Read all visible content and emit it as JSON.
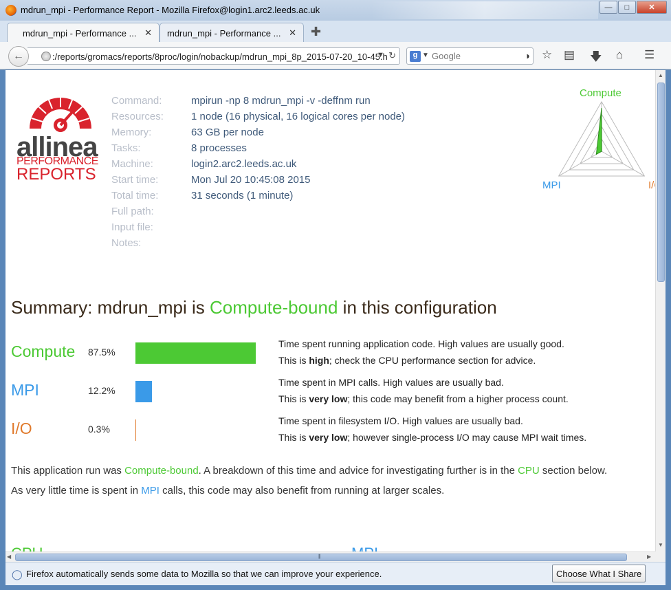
{
  "window": {
    "title": "mdrun_mpi - Performance Report - Mozilla Firefox@login1.arc2.leeds.ac.uk"
  },
  "tabs": [
    {
      "label": "mdrun_mpi - Performance ...",
      "active": true
    },
    {
      "label": "mdrun_mpi - Performance ...",
      "active": false
    }
  ],
  "nav": {
    "url": ":/reports/gromacs/reports/8proc/login/nobackup/mdrun_mpi_8p_2015-07-20_10-45.h",
    "search_placeholder": "Google",
    "search_engine_icon": "g"
  },
  "logo": {
    "word": "allinea",
    "sub1": "PERFORMANCE",
    "sub2": "REPORTS"
  },
  "meta": [
    {
      "label": "Command:",
      "value": "mpirun -np 8 mdrun_mpi -v -deffnm run"
    },
    {
      "label": "Resources:",
      "value": "1 node (16 physical, 16 logical cores per node)"
    },
    {
      "label": "Memory:",
      "value": "63 GB per node"
    },
    {
      "label": "Tasks:",
      "value": "8 processes"
    },
    {
      "label": "Machine:",
      "value": "login2.arc2.leeds.ac.uk"
    },
    {
      "label": "Start time:",
      "value": "Mon Jul 20 10:45:08 2015"
    },
    {
      "label": "Total time:",
      "value": "31 seconds (1 minute)"
    },
    {
      "label": "Full path:",
      "value": ""
    },
    {
      "label": "Input file:",
      "value": ""
    },
    {
      "label": "Notes:",
      "value": ""
    }
  ],
  "radar": {
    "labels": {
      "top": "Compute",
      "left": "MPI",
      "right": "I/O"
    },
    "values": {
      "compute": 87.5,
      "mpi": 12.2,
      "io": 0.3
    }
  },
  "summary": {
    "prefix": "Summary: mdrun_mpi is ",
    "highlight": "Compute-bound",
    "suffix": " in this configuration"
  },
  "metrics": [
    {
      "name": "Compute",
      "pct": "87.5%",
      "value": 87.5,
      "color": "#4cc934",
      "desc1": "Time spent running application code. High values are usually good.",
      "desc2_pre": "This is ",
      "desc2_bold": "high",
      "desc2_post": "; check the CPU performance section for advice."
    },
    {
      "name": "MPI",
      "pct": "12.2%",
      "value": 12.2,
      "color": "#3a9ae8",
      "desc1": "Time spent in MPI calls. High values are usually bad.",
      "desc2_pre": "This is ",
      "desc2_bold": "very low",
      "desc2_post": "; this code may benefit from a higher process count."
    },
    {
      "name": "I/O",
      "pct": "0.3%",
      "value": 0.3,
      "color": "#e07a2c",
      "desc1": "Time spent in filesystem I/O. High values are usually bad.",
      "desc2_pre": "This is ",
      "desc2_bold": "very low",
      "desc2_post": "; however single-process I/O may cause MPI wait times."
    }
  ],
  "para1": {
    "a": "This application run was ",
    "b": "Compute-bound",
    "c": ". A breakdown of this time and advice for investigating further is in the ",
    "d": "CPU",
    "e": " section below."
  },
  "para2": {
    "a": "As very little time is spent in ",
    "b": "MPI",
    "c": " calls, this code may also benefit from running at larger scales."
  },
  "section_headers": {
    "left": "CPU",
    "right": "MPI"
  },
  "notification": {
    "text": "Firefox automatically sends some data to Mozilla so that we can improve your experience.",
    "button": "Choose What I Share"
  },
  "colors": {
    "compute": "#4cc934",
    "mpi": "#3a9ae8",
    "io": "#e07a2c",
    "brand_red": "#d9232d"
  }
}
